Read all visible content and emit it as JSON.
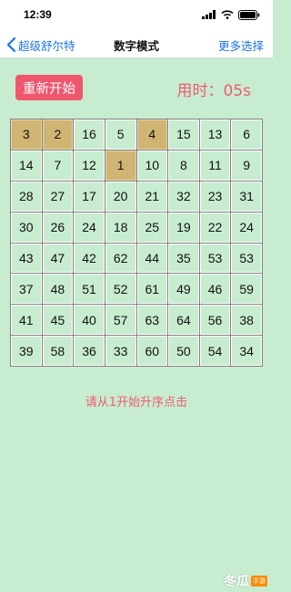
{
  "status_bar": {
    "time": "12:39"
  },
  "nav": {
    "back_label": "超级舒尔特",
    "title": "数字模式",
    "right_label": "更多选择"
  },
  "controls": {
    "restart_label": "重新开始",
    "timer_prefix": "用时：",
    "timer_value": "05s"
  },
  "grid": {
    "rows": 8,
    "cols": 8,
    "cells": [
      [
        "3",
        "2",
        "16",
        "5",
        "4",
        "15",
        "13",
        "6"
      ],
      [
        "14",
        "7",
        "12",
        "1",
        "10",
        "8",
        "11",
        "9"
      ],
      [
        "28",
        "27",
        "17",
        "20",
        "21",
        "32",
        "23",
        "31"
      ],
      [
        "30",
        "26",
        "24",
        "18",
        "25",
        "19",
        "22",
        "24"
      ],
      [
        "43",
        "47",
        "42",
        "62",
        "44",
        "35",
        "53",
        "53"
      ],
      [
        "37",
        "48",
        "51",
        "52",
        "61",
        "49",
        "46",
        "59"
      ],
      [
        "41",
        "45",
        "40",
        "57",
        "63",
        "64",
        "56",
        "38"
      ],
      [
        "39",
        "58",
        "36",
        "33",
        "60",
        "50",
        "54",
        "34"
      ]
    ],
    "clicked": [
      "3",
      "2",
      "4",
      "1"
    ]
  },
  "hint": "请从1开始升序点击",
  "watermark": {
    "text": "冬瓜",
    "sub": "手游"
  },
  "colors": {
    "background": "#c8ecd0",
    "accent_red": "#f0556e",
    "done_cell": "#d0b473",
    "link_blue": "#1a73e8"
  }
}
